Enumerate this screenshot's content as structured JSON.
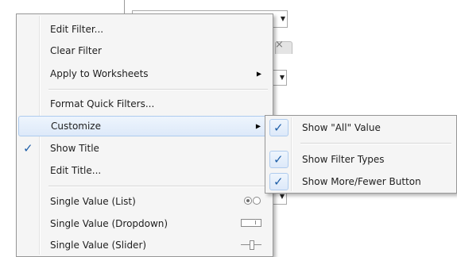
{
  "context_menu": {
    "items": [
      {
        "label": "Edit Filter..."
      },
      {
        "label": "Clear Filter"
      },
      {
        "label": "Apply to Worksheets",
        "has_submenu": true
      },
      {
        "label": "Format Quick Filters..."
      },
      {
        "label": "Customize",
        "has_submenu": true,
        "highlighted": true
      },
      {
        "label": "Show Title",
        "checked": true
      },
      {
        "label": "Edit Title..."
      },
      {
        "label": "Single Value (List)",
        "icon": "radio-buttons-icon"
      },
      {
        "label": "Single Value (Dropdown)",
        "icon": "dropdown-icon"
      },
      {
        "label": "Single Value (Slider)",
        "icon": "slider-icon"
      }
    ],
    "check_glyph": "✓",
    "submenu_arrow": "▶"
  },
  "customize_submenu": {
    "items": [
      {
        "label": "Show \"All\" Value",
        "checked": true
      },
      {
        "label": "Show Filter Types",
        "checked": true
      },
      {
        "label": "Show More/Fewer Button",
        "checked": true
      }
    ]
  },
  "background": {
    "dropdown_arrow": "▼",
    "close_glyph": "×"
  },
  "colors": {
    "menu_bg": "#f5f5f5",
    "highlight": "#dde9f9",
    "check": "#1f5fa8"
  }
}
